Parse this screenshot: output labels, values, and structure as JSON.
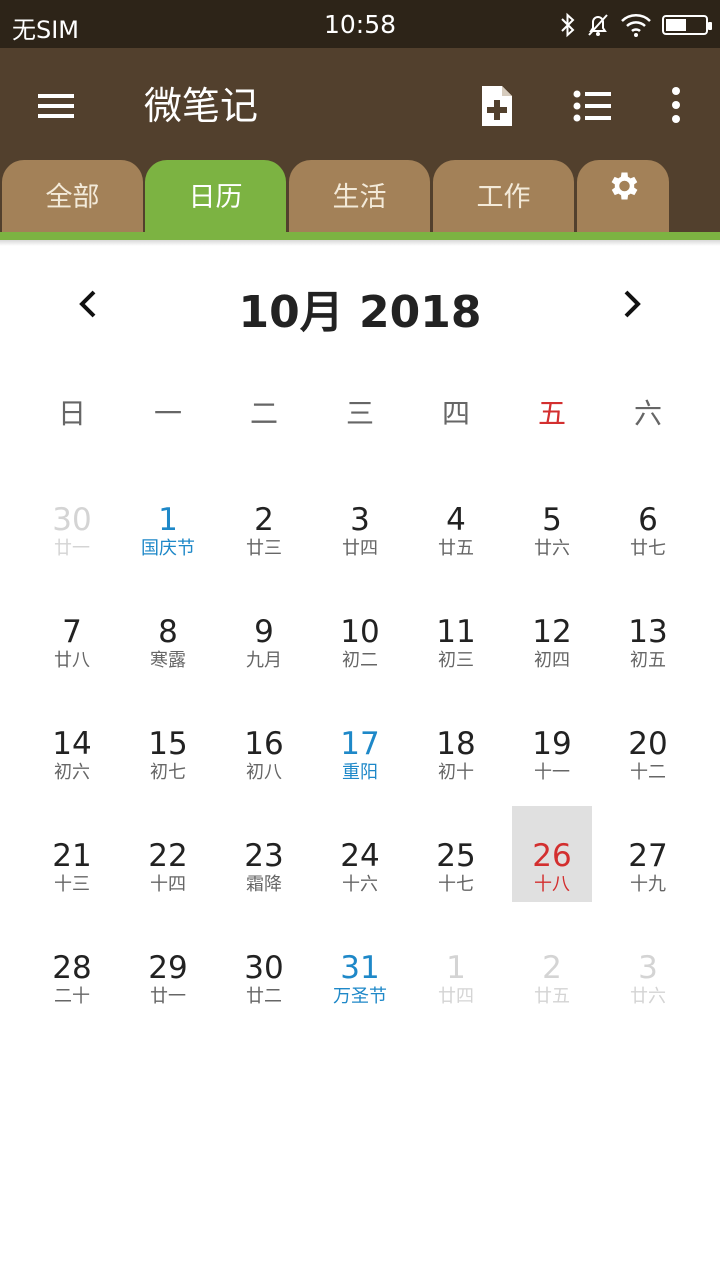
{
  "status": {
    "carrier": "无SIM",
    "time": "10:58"
  },
  "appbar": {
    "title": "微笔记",
    "icons": [
      "menu-icon",
      "add-note-icon",
      "list-icon",
      "more-vertical-icon"
    ]
  },
  "tabs": [
    {
      "label": "全部"
    },
    {
      "label": "日历"
    },
    {
      "label": "生活"
    },
    {
      "label": "工作"
    }
  ],
  "active_tab": 1,
  "calendar": {
    "month_title": "10月 2018",
    "weekdays": [
      "日",
      "一",
      "二",
      "三",
      "四",
      "五",
      "六"
    ],
    "colors": {
      "holiday": "#1e88c8",
      "today": "#d32f2f",
      "other_month": "#d4d4d4",
      "accent": "#7cb342",
      "appbar": "#52402d"
    },
    "weeks": [
      [
        {
          "day": "30",
          "lunar": "廿一",
          "other": true
        },
        {
          "day": "1",
          "lunar": "国庆节",
          "holiday": true
        },
        {
          "day": "2",
          "lunar": "廿三"
        },
        {
          "day": "3",
          "lunar": "廿四"
        },
        {
          "day": "4",
          "lunar": "廿五"
        },
        {
          "day": "5",
          "lunar": "廿六"
        },
        {
          "day": "6",
          "lunar": "廿七"
        }
      ],
      [
        {
          "day": "7",
          "lunar": "廿八"
        },
        {
          "day": "8",
          "lunar": "寒露"
        },
        {
          "day": "9",
          "lunar": "九月"
        },
        {
          "day": "10",
          "lunar": "初二"
        },
        {
          "day": "11",
          "lunar": "初三"
        },
        {
          "day": "12",
          "lunar": "初四"
        },
        {
          "day": "13",
          "lunar": "初五"
        }
      ],
      [
        {
          "day": "14",
          "lunar": "初六"
        },
        {
          "day": "15",
          "lunar": "初七"
        },
        {
          "day": "16",
          "lunar": "初八"
        },
        {
          "day": "17",
          "lunar": "重阳",
          "holiday": true
        },
        {
          "day": "18",
          "lunar": "初十"
        },
        {
          "day": "19",
          "lunar": "十一"
        },
        {
          "day": "20",
          "lunar": "十二"
        }
      ],
      [
        {
          "day": "21",
          "lunar": "十三"
        },
        {
          "day": "22",
          "lunar": "十四"
        },
        {
          "day": "23",
          "lunar": "霜降"
        },
        {
          "day": "24",
          "lunar": "十六"
        },
        {
          "day": "25",
          "lunar": "十七"
        },
        {
          "day": "26",
          "lunar": "十八",
          "today": true
        },
        {
          "day": "27",
          "lunar": "十九"
        }
      ],
      [
        {
          "day": "28",
          "lunar": "二十"
        },
        {
          "day": "29",
          "lunar": "廿一"
        },
        {
          "day": "30",
          "lunar": "廿二"
        },
        {
          "day": "31",
          "lunar": "万圣节",
          "holiday": true
        },
        {
          "day": "1",
          "lunar": "廿四",
          "other": true
        },
        {
          "day": "2",
          "lunar": "廿五",
          "other": true
        },
        {
          "day": "3",
          "lunar": "廿六",
          "other": true
        }
      ]
    ]
  }
}
